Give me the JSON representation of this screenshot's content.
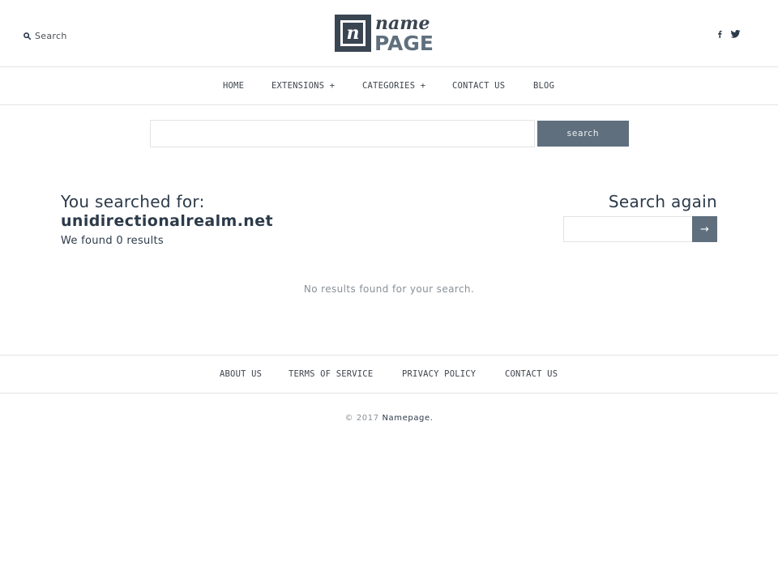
{
  "header": {
    "search_label": "Search",
    "logo": {
      "word_top": "name",
      "word_bottom": "PAGE",
      "mark": "n",
      "icon": "logo-icon"
    },
    "social": [
      {
        "name": "facebook",
        "icon": "facebook-icon",
        "glyph": "f"
      },
      {
        "name": "twitter",
        "icon": "twitter-icon"
      }
    ]
  },
  "nav": {
    "items": [
      {
        "label": "HOME"
      },
      {
        "label": "EXTENSIONS +"
      },
      {
        "label": "CATEGORIES +"
      },
      {
        "label": "CONTACT US"
      },
      {
        "label": "BLOG"
      }
    ]
  },
  "main_search": {
    "value": "",
    "placeholder": "",
    "button_label": "search"
  },
  "results": {
    "title": "You searched for:",
    "query": "unidirectionalrealm.net",
    "count_text": "We found 0 results",
    "empty_message": "No results found for your search."
  },
  "search_again": {
    "title": "Search again",
    "value": "",
    "button_label": "→"
  },
  "footer": {
    "links": [
      {
        "label": "ABOUT US"
      },
      {
        "label": "TERMS OF SERVICE"
      },
      {
        "label": "PRIVACY POLICY"
      },
      {
        "label": "CONTACT US"
      }
    ],
    "copyright_prefix": "© 2017",
    "copyright_link": "Namepage."
  },
  "colors": {
    "accent": "#5f6f7d",
    "text": "#2c3a4a",
    "muted": "#8a9097",
    "border": "#e3e3e3"
  }
}
